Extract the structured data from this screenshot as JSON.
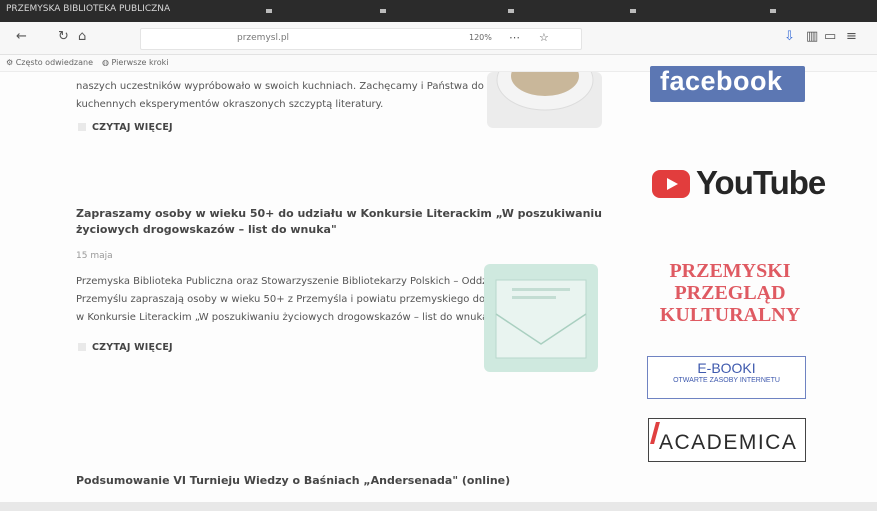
{
  "browser": {
    "tab_title": "PRZEMYSKA BIBLIOTEKA PUBLICZNA",
    "url": "przemysl.pl",
    "zoom": "120%",
    "bookmarks": [
      "Często odwiedzane",
      "Pierwsze kroki"
    ]
  },
  "articles": [
    {
      "excerpt_lines": [
        "naszych uczestników wypróbowało w swoich kuchniach. Zachęcamy i Państwa do",
        "kuchennych eksperymentów okraszonych szczyptą literatury."
      ],
      "read_more": "CZYTAJ WIĘCEJ"
    },
    {
      "title_lines": [
        "Zapraszamy osoby w wieku 50+ do udziału w Konkursie Literackim „W poszukiwaniu",
        "życiowych drogowskazów – list do wnuka\""
      ],
      "date": "15 maja",
      "excerpt_lines": [
        "Przemyska Biblioteka Publiczna oraz Stowarzyszenie Bibliotekarzy Polskich – Oddział w",
        "Przemyślu zapraszają osoby w wieku 50+ z Przemyśla i powiatu przemyskiego do udziału",
        "w Konkursie Literackim „W poszukiwaniu życiowych drogowskazów – list do wnuka\""
      ],
      "read_more": "CZYTAJ WIĘCEJ"
    },
    {
      "title_lines": [
        "Podsumowanie VI Turnieju Wiedzy o Baśniach „Andersenada\" (online)"
      ]
    }
  ],
  "sidebar": {
    "facebook": "facebook",
    "youtube": "YouTube",
    "przeglad_lines": [
      "PRZEMYSKI",
      "PRZEGLĄD",
      "KULTURALNY"
    ],
    "ebooks_title": "E-BOOKI",
    "ebooks_subtitle": "OTWARTE ZASOBY INTERNETU",
    "academica": "ACADEMICA"
  },
  "colors": {
    "facebook": "#5c77b3",
    "youtube_red": "#e23d3d",
    "przeglad_red": "#df5a62",
    "ebooks_blue": "#3f5aae"
  }
}
